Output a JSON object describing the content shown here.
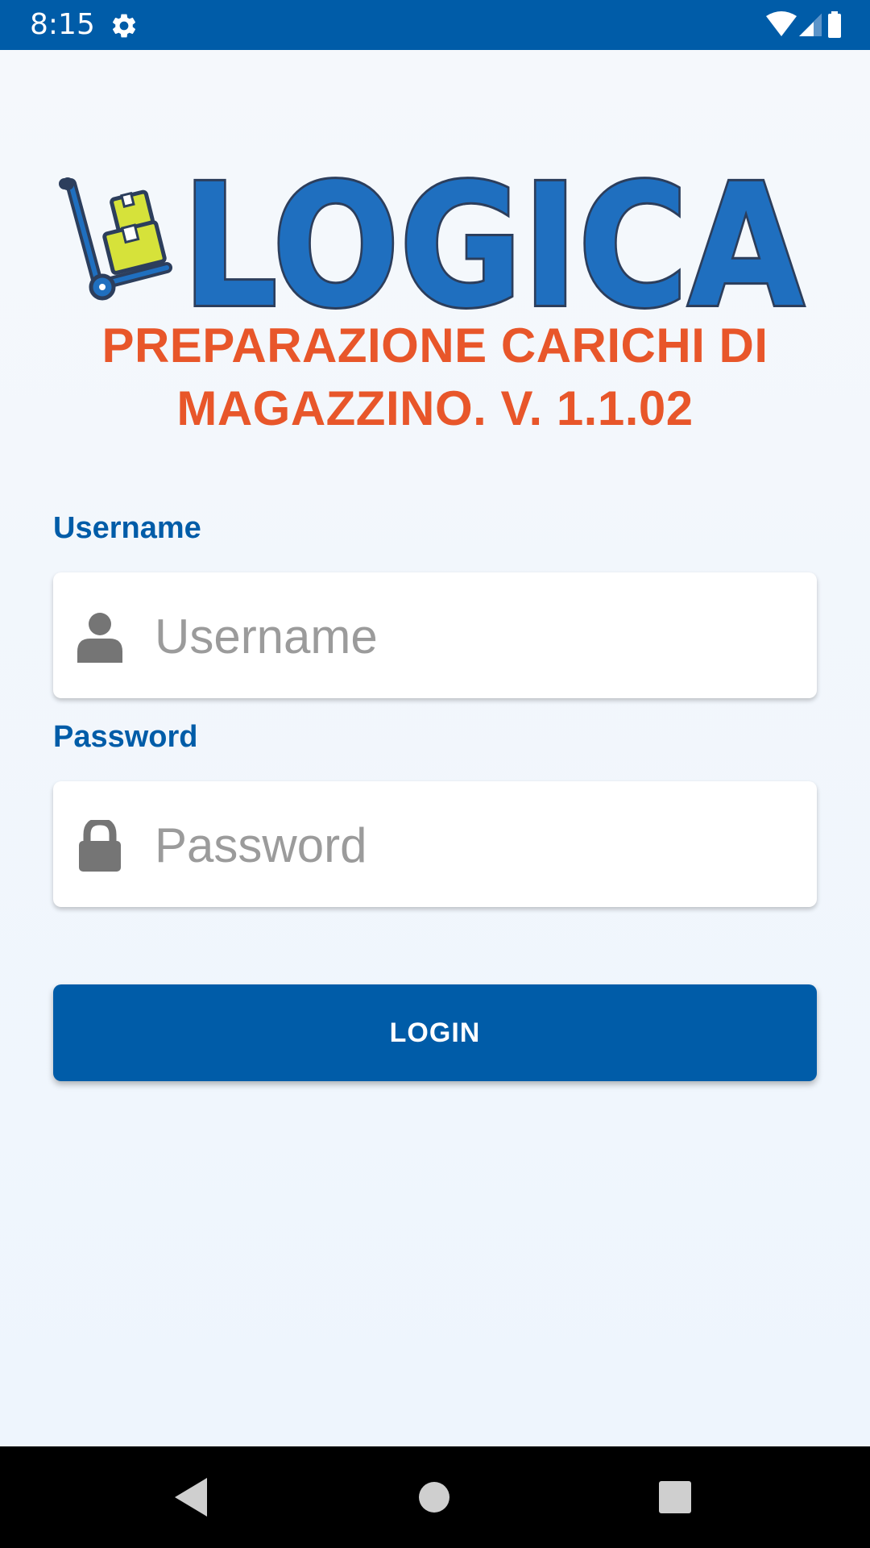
{
  "status_bar": {
    "time": "8:15",
    "icons": [
      "gear-icon",
      "wifi-icon",
      "cellular-signal-icon",
      "battery-icon"
    ],
    "background_color": "#005ca8"
  },
  "logo": {
    "text": "LOGICA",
    "icon": "hand-truck-boxes-icon",
    "fill_color": "#1f6fbf",
    "outline_color": "#2c3e5c",
    "box_color": "#d6e23a"
  },
  "app_title": "PREPARAZIONE CARICHI DI MAGAZZINO. V. 1.1.02",
  "form": {
    "username": {
      "label": "Username",
      "placeholder": "Username",
      "value": "",
      "icon": "person-icon"
    },
    "password": {
      "label": "Password",
      "placeholder": "Password",
      "value": "",
      "icon": "lock-icon"
    },
    "login_button": "LOGIN"
  },
  "nav_bar": {
    "buttons": [
      "back-icon",
      "home-icon",
      "recents-icon"
    ]
  },
  "colors": {
    "accent": "#005ca8",
    "title": "#e8562a",
    "placeholder": "#9b9b9b",
    "background": "#f1f6fc"
  }
}
